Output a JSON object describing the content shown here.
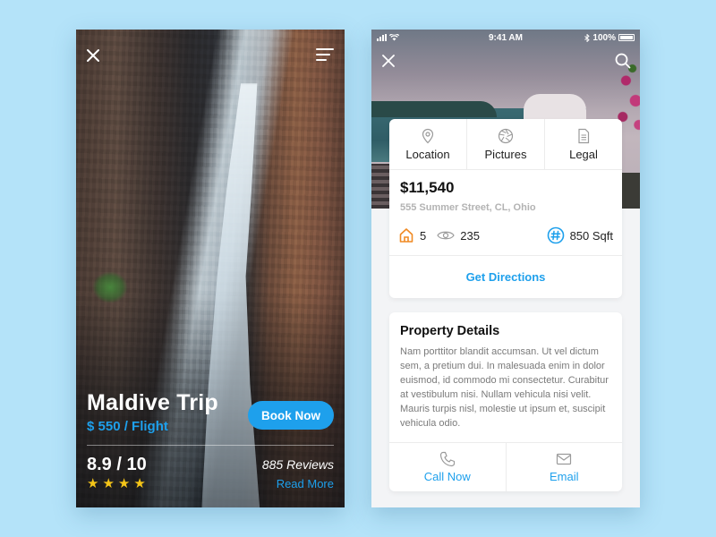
{
  "trip_screen": {
    "title": "Maldive Trip",
    "price": "$ 550 / Flight",
    "book_button": "Book Now",
    "rating": "8.9 / 10",
    "stars": 4,
    "star_glyph": "★",
    "reviews": "885 Reviews",
    "read_more": "Read More",
    "icons": {
      "close": "close-icon",
      "menu": "menu-icon"
    }
  },
  "property_screen": {
    "status_bar": {
      "time": "9:41 AM",
      "battery": "100%"
    },
    "tabs": [
      {
        "label": "Location",
        "icon": "location-pin-icon"
      },
      {
        "label": "Pictures",
        "icon": "camera-aperture-icon"
      },
      {
        "label": "Legal",
        "icon": "document-icon"
      }
    ],
    "price": "$11,540",
    "address": "555 Summer Street, CL, Ohio",
    "stats": {
      "rooms": "5",
      "views": "235",
      "area": "850 Sqft"
    },
    "directions_button": "Get Directions",
    "details": {
      "title": "Property Details",
      "body": "Nam porttitor blandit accumsan. Ut vel dictum sem, a pretium dui. In malesuada enim in dolor euismod, id commodo mi consectetur. Curabitur at vestibulum nisi. Nullam vehicula nisi velit. Mauris turpis nisl, molestie ut ipsum et, suscipit vehicula odio."
    },
    "contact": [
      {
        "label": "Call Now",
        "icon": "phone-icon"
      },
      {
        "label": "Email",
        "icon": "mail-icon"
      }
    ]
  },
  "colors": {
    "background": "#b4e3f9",
    "accent": "#1ea0ec",
    "star": "#f5c518",
    "home_icon": "#f08a24"
  }
}
